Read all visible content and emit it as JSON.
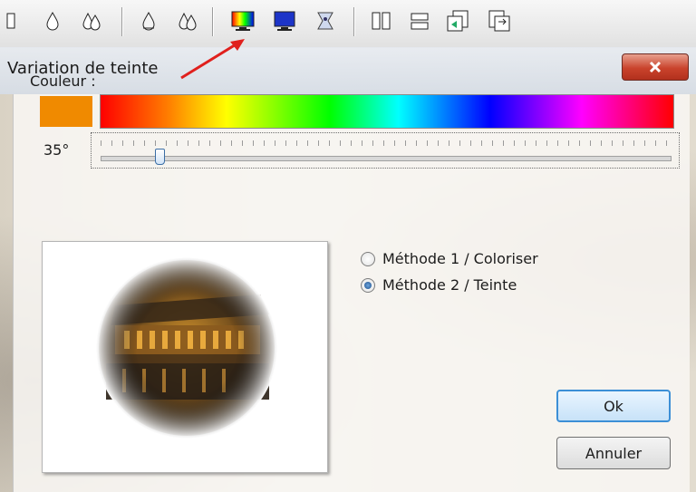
{
  "toolbar": {
    "icons": [
      "page-icon",
      "drop-icon",
      "drops-icon",
      "drop-outline-icon",
      "drops-outline-icon",
      "hue-variation-icon",
      "blue-monitor-icon",
      "sparkle-icon",
      "split-page-icon",
      "align-icon",
      "copy-icon",
      "export-icon"
    ]
  },
  "dialog": {
    "title": "Variation de teinte",
    "close_label": "X",
    "couleur_label": "Couleur :",
    "swatch_color": "#f08a00",
    "angle_label": "35°",
    "slider_value_deg": 35,
    "method1_label": "Méthode 1 / Coloriser",
    "method2_label": "Méthode 2 / Teinte",
    "selected_method": 2,
    "ok_label": "Ok",
    "cancel_label": "Annuler"
  },
  "colors": {
    "accent": "#3c8fd6",
    "close_red": "#c9432c",
    "annotation_arrow": "#e0201d"
  }
}
